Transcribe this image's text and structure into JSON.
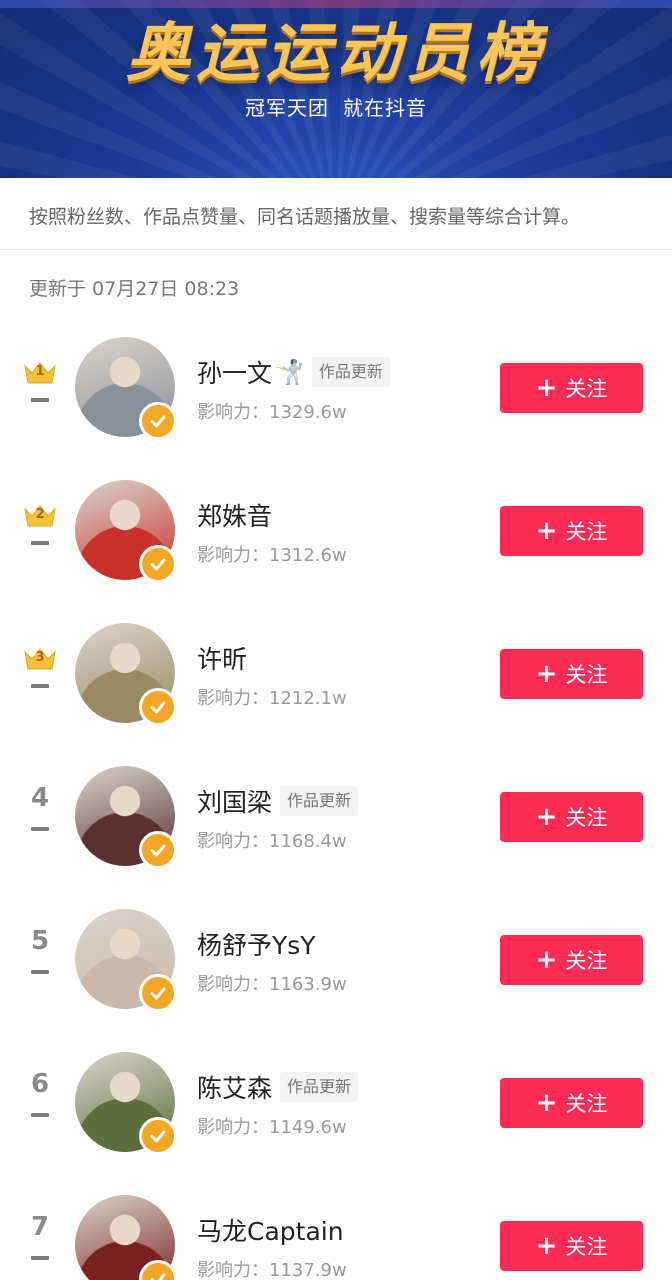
{
  "banner": {
    "title": "奥运运动员榜",
    "subtitle_left": "冠军天团",
    "subtitle_right": "就在抖音"
  },
  "description": "按照粉丝数、作品点赞量、同名话题播放量、搜索量等综合计算。",
  "updated": "更新于 07月27日 08:23",
  "follow_label": "关注",
  "influence_prefix": "影响力：",
  "colors": {
    "follow_button": "#fe2c55",
    "verified_badge": "#f5a623",
    "crown": "#f5c13a",
    "banner_gold": "#f8c558"
  },
  "rankings": [
    {
      "rank": "1",
      "crown": true,
      "name": "孙一文",
      "icon": "fencing-icon",
      "tag": "作品更新",
      "influence": "1329.6w",
      "avatar_color": "#8b8f96"
    },
    {
      "rank": "2",
      "crown": true,
      "name": "郑姝音",
      "icon": "",
      "tag": "",
      "influence": "1312.6w",
      "avatar_color": "#c8322b"
    },
    {
      "rank": "3",
      "crown": true,
      "name": "许昕",
      "icon": "",
      "tag": "",
      "influence": "1212.1w",
      "avatar_color": "#9a8a63"
    },
    {
      "rank": "4",
      "crown": false,
      "name": "刘国梁",
      "icon": "",
      "tag": "作品更新",
      "influence": "1168.4w",
      "avatar_color": "#5a3030"
    },
    {
      "rank": "5",
      "crown": false,
      "name": "杨舒予YsY",
      "icon": "",
      "tag": "",
      "influence": "1163.9w",
      "avatar_color": "#c9b8a8"
    },
    {
      "rank": "6",
      "crown": false,
      "name": "陈艾森",
      "icon": "",
      "tag": "作品更新",
      "influence": "1149.6w",
      "avatar_color": "#5c6e3a"
    },
    {
      "rank": "7",
      "crown": false,
      "name": "马龙Captain",
      "icon": "",
      "tag": "",
      "influence": "1137.9w",
      "avatar_color": "#7a2020"
    }
  ]
}
